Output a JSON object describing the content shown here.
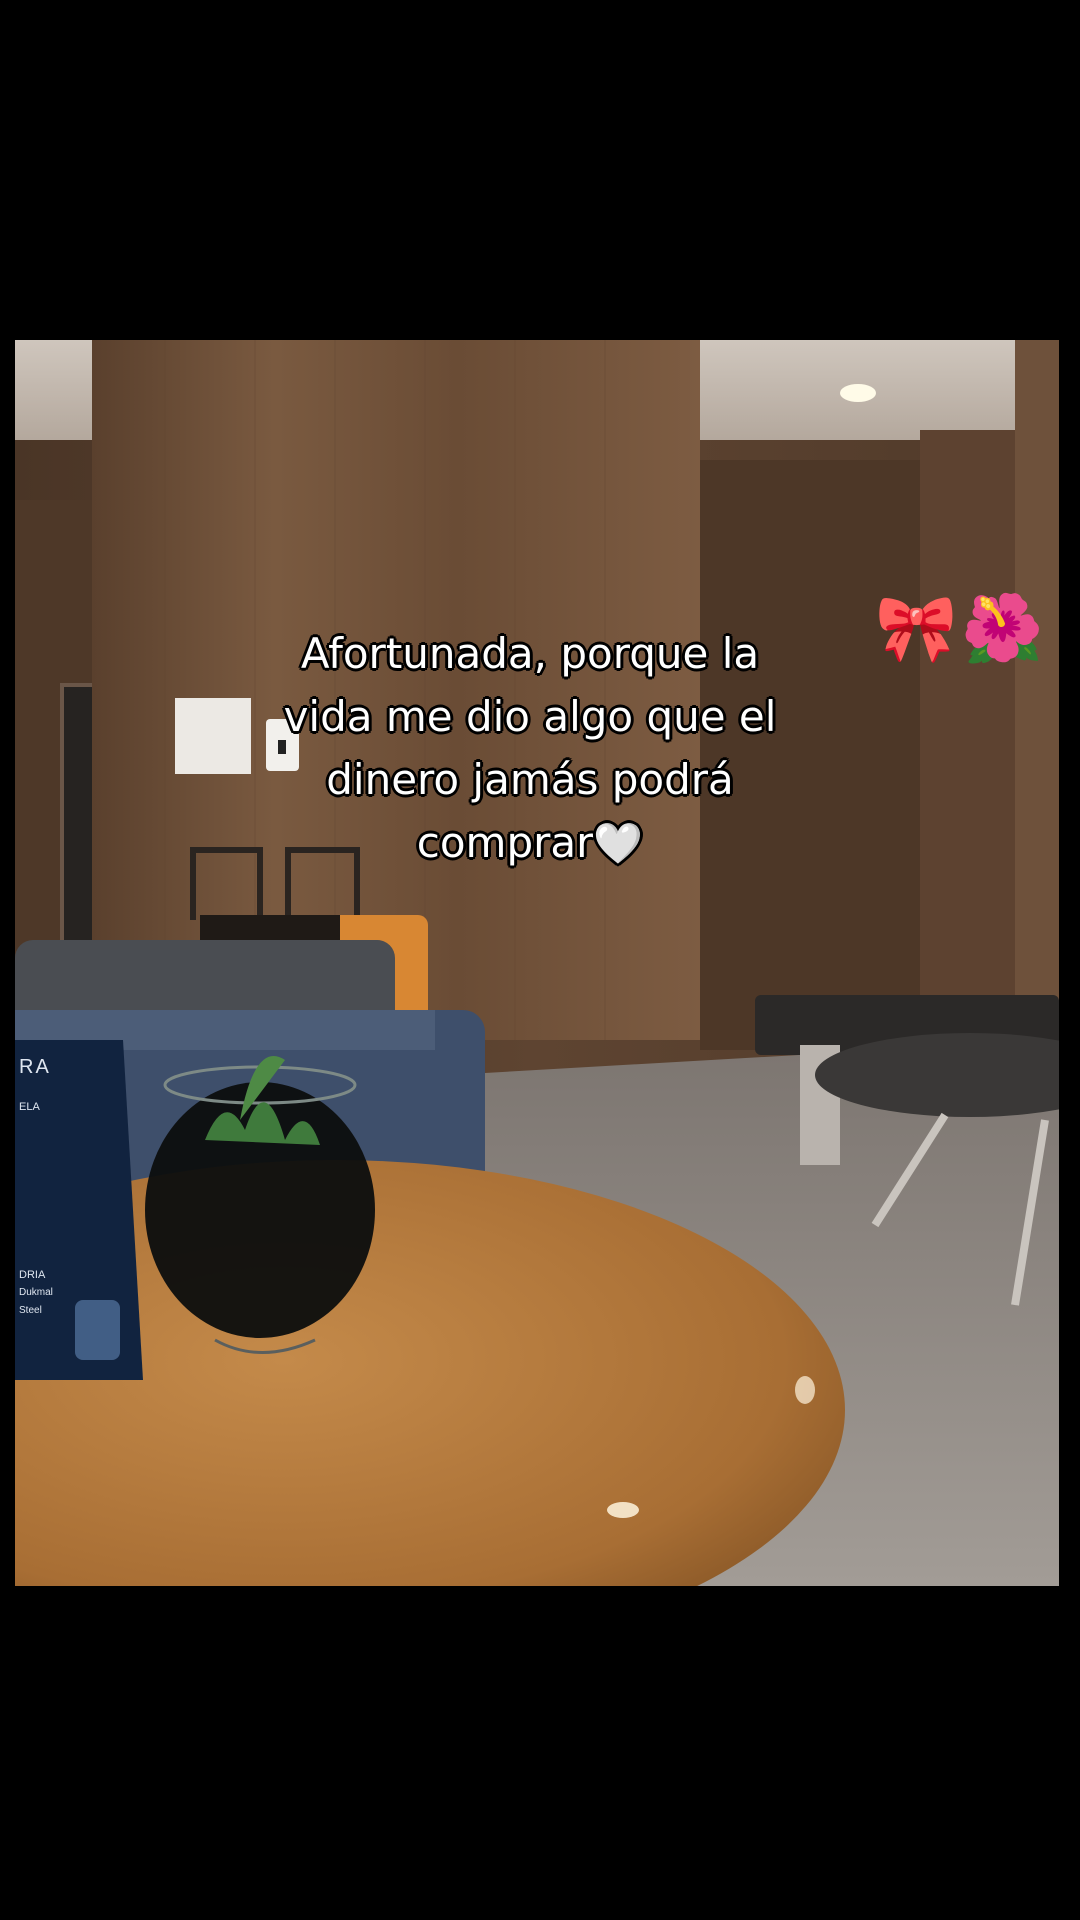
{
  "caption": {
    "line1": "Afortunada, porque la",
    "line2": "vida me dio algo que el",
    "line3": "dinero jamás podrá",
    "line4": "comprar",
    "emoji": "🤍"
  },
  "stickers": {
    "bow": "🎀",
    "flower": "🌺"
  },
  "tent_card": {
    "brand": "RA",
    "sub": "ELA",
    "line_a": "DRIA",
    "line_b": "Dukmal",
    "line_c": "Steel"
  },
  "colors": {
    "background": "#000000",
    "wood_panel": "#6b4e37",
    "table": "#b07a3f",
    "floor": "#8a8580"
  }
}
